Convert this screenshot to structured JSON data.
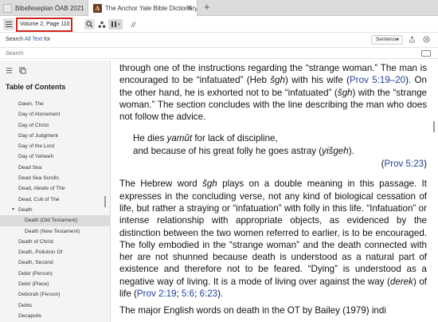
{
  "tabs": [
    {
      "label": "Bibelleseplan ÖAB 2021"
    },
    {
      "label": "The Anchor Yale Bible Dictionary"
    }
  ],
  "tab_icon_letter": "A",
  "toolbar": {
    "reference": "Volume 2, Page 110",
    "search_icon": "search-icon",
    "visual_filter_icon": "visual-filter-icon",
    "parallel_icon": "parallel-resources-icon",
    "slash_label": "//"
  },
  "search": {
    "prefix": "Search",
    "scope": "All Text",
    "suffix": "for",
    "mode": "Sentence",
    "placeholder": "Search",
    "value": ""
  },
  "sidebar": {
    "title": "Table of Contents",
    "items": [
      {
        "label": "Dawn, The"
      },
      {
        "label": "Day of Atonement"
      },
      {
        "label": "Day of Christ"
      },
      {
        "label": "Day of Judgment"
      },
      {
        "label": "Day of the Lord"
      },
      {
        "label": "Day of Yahweh"
      },
      {
        "label": "Dead Sea"
      },
      {
        "label": "Dead Sea Scrolls"
      },
      {
        "label": "Dead, Abode of The"
      },
      {
        "label": "Dead, Cult of The"
      },
      {
        "label": "Death"
      },
      {
        "label": "Death (Old Testament)"
      },
      {
        "label": "Death (New Testament)"
      },
      {
        "label": "Death of Christ"
      },
      {
        "label": "Death, Pollution Of"
      },
      {
        "label": "Death, Second"
      },
      {
        "label": "Debir (Person)"
      },
      {
        "label": "Debir (Place)"
      },
      {
        "label": "Deborah (Person)"
      },
      {
        "label": "Debts"
      },
      {
        "label": "Decapolis"
      }
    ]
  },
  "article": {
    "p1": {
      "t1": "through one of the instructions regarding the “strange woman.” The man is encouraged to be “infatuated” (Heb ",
      "w1": "šgh",
      "t2": ") with his wife (",
      "r1": "Prov 5:19–20",
      "t3": "). On the other hand, he is exhorted not to be “infatuated” (",
      "w2": "šgh",
      "t4": ") with the “strange woman.” The section concludes with the line describing the man who does not follow the advice."
    },
    "quote": {
      "l1a": "He dies ",
      "l1b": "yamût",
      "l1c": " for lack of discipline,",
      "l2a": "and because of his great folly he goes astray (",
      "l2b": "yišgeh",
      "l2c": ").",
      "ref": "Prov 5:23"
    },
    "p2": {
      "t1": "The Hebrew word ",
      "w1": "šgh",
      "t2": " plays on a double meaning in this passage. It expresses in the concluding verse, not any kind of biological cessation of life, but rather a straying or “infatuation” with folly in this life. “Infatuation” or intense relationship with appropriate objects, as evidenced by the distinction between the two women referred to earlier, is to be encouraged. The folly embodied in the “strange woman” and the death connected with her are not shunned because death is understood as a natural part of existence and therefore not to be feared. “Dying” is understood as a negative way of living. It is a mode of living over against the way (",
      "w2": "derek",
      "t3": ") of life (",
      "r1": "Prov 2:19",
      "t4": "; ",
      "r2": "5:6",
      "t5": "; ",
      "r3": "6:23",
      "t6": ")."
    },
    "p3": "The major English words on death in the OT by Bailey (1979) indi"
  }
}
